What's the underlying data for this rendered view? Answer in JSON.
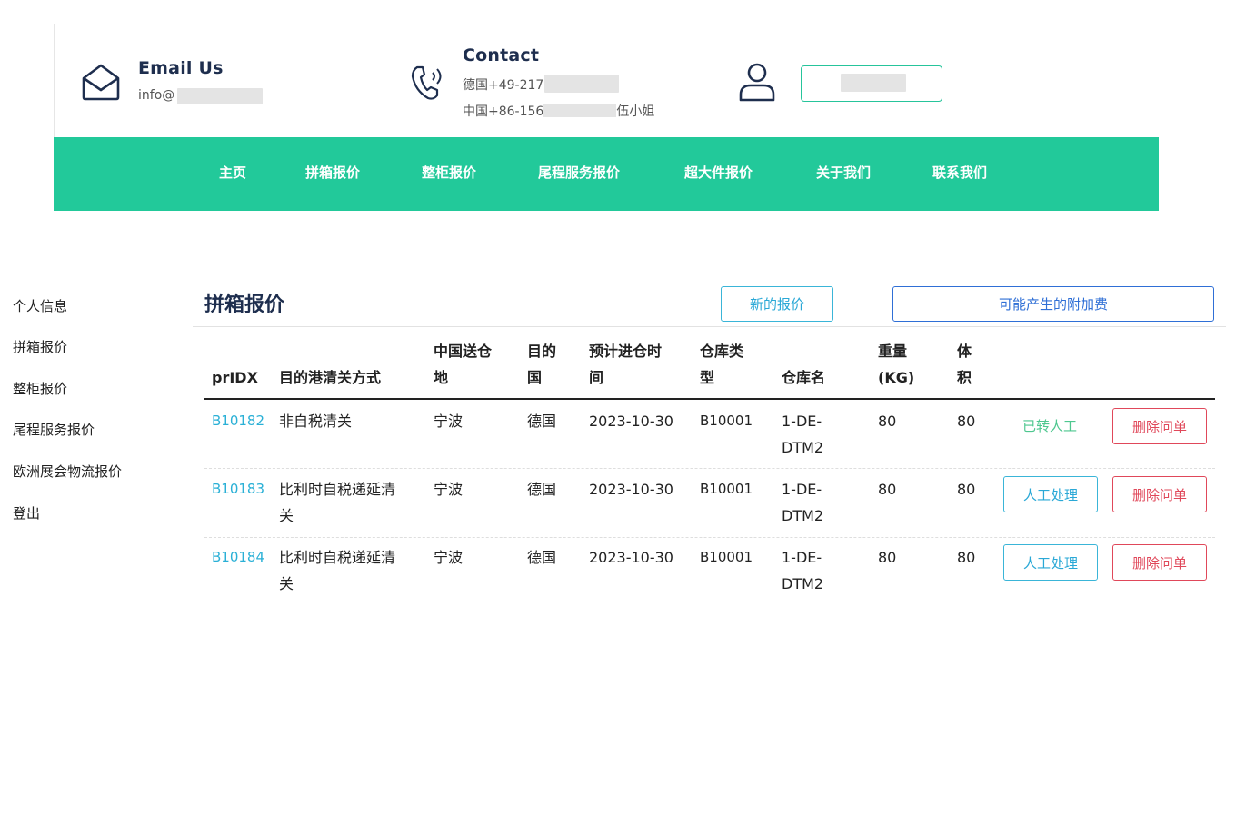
{
  "header": {
    "email": {
      "title": "Email Us",
      "value_visible": "info@"
    },
    "contact": {
      "title": "Contact",
      "line1_visible": "德国+49-217",
      "line2_prefix": "中国+86-156",
      "line2_suffix": "伍小姐"
    }
  },
  "nav": {
    "items": [
      "主页",
      "拼箱报价",
      "整柜报价",
      "尾程服务报价",
      "超大件报价",
      "关于我们",
      "联系我们"
    ]
  },
  "sidebar": {
    "items": [
      "个人信息",
      "拼箱报价",
      "整柜报价",
      "尾程服务报价",
      "欧洲展会物流报价",
      "登出"
    ]
  },
  "main": {
    "title": "拼箱报价",
    "new_quote_label": "新的报价",
    "surcharge_label": "可能产生的附加费",
    "table": {
      "headers": {
        "prIDX": "prIDX",
        "clearance": "目的港清关方式",
        "origin_1": "中国送仓",
        "origin_2": "地",
        "dest_1": "目的",
        "dest_2": "国",
        "eta_1": "预计进仓时",
        "eta_2": "间",
        "wtype_1": "仓库类",
        "wtype_2": "型",
        "wname": "仓库名",
        "weight_1": "重量",
        "weight_2": "(KG)",
        "volume_1": "体",
        "volume_2": "积"
      },
      "rows": [
        {
          "id": "B10182",
          "clearance_1": "非自税清关",
          "clearance_2": "",
          "origin": "宁波",
          "dest": "德国",
          "eta": "2023-10-30",
          "wtype": "B10001",
          "wname_1": "1-DE-",
          "wname_2": "DTM2",
          "weight": "80",
          "volume": "80",
          "status": "已转人工",
          "delete": "删除问单"
        },
        {
          "id": "B10183",
          "clearance_1": "比利时自税递延清",
          "clearance_2": "关",
          "origin": "宁波",
          "dest": "德国",
          "eta": "2023-10-30",
          "wtype": "B10001",
          "wname_1": "1-DE-",
          "wname_2": "DTM2",
          "weight": "80",
          "volume": "80",
          "action": "人工处理",
          "delete": "删除问单"
        },
        {
          "id": "B10184",
          "clearance_1": "比利时自税递延清",
          "clearance_2": "关",
          "origin": "宁波",
          "dest": "德国",
          "eta": "2023-10-30",
          "wtype": "B10001",
          "wname_1": "1-DE-",
          "wname_2": "DTM2",
          "weight": "80",
          "volume": "80",
          "action": "人工处理",
          "delete": "删除问单"
        }
      ]
    }
  },
  "colors": {
    "brand_green": "#22c99a",
    "link_blue": "#2ab0d6",
    "danger_red": "#e0485a",
    "navy": "#1e2e4e"
  }
}
